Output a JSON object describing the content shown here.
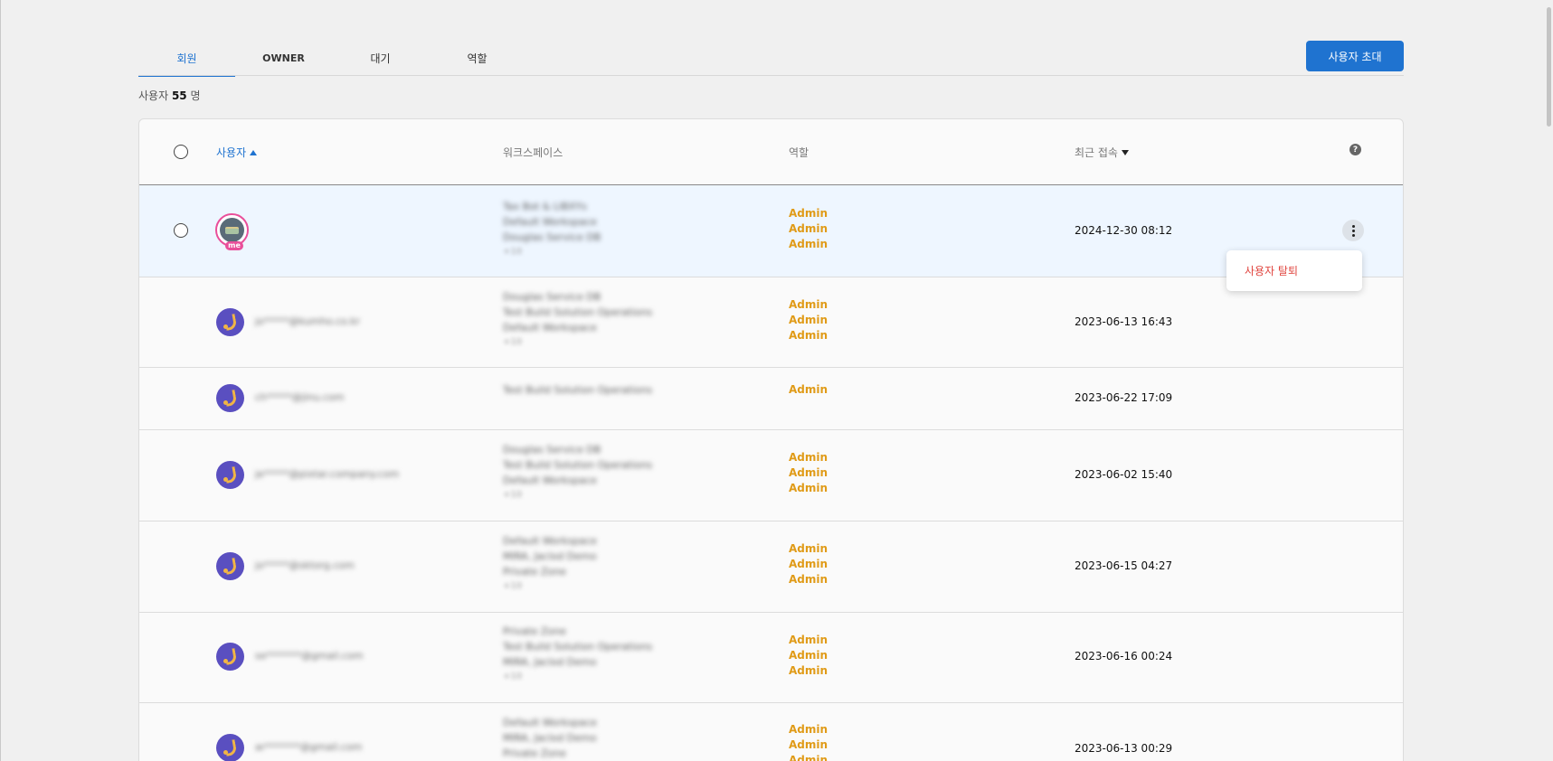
{
  "tabs": [
    {
      "label": "회원",
      "active": true
    },
    {
      "label": "OWNER",
      "active": false
    },
    {
      "label": "대기",
      "active": false
    },
    {
      "label": "역할",
      "active": false
    }
  ],
  "invite_button": "사용자 초대",
  "count": {
    "prefix": "사용자",
    "value": "55",
    "suffix": "명"
  },
  "columns": {
    "user": "사용자",
    "workspace": "워크스페이스",
    "role": "역할",
    "last_access": "최근 접속",
    "help": "?"
  },
  "rows": [
    {
      "me_badge": "me",
      "email": "",
      "workspaces": [
        "Tax Bot & LIBXYs",
        "Default Workspace",
        "Douglas Service DB"
      ],
      "more": "+10",
      "roles": [
        "Admin",
        "Admin",
        "Admin"
      ],
      "last_access": "2024-12-30 08:12"
    },
    {
      "email": "jo*****@kumho.co.kr",
      "workspaces": [
        "Douglas Service DB",
        "Test Build Solution Operations",
        "Default Workspace"
      ],
      "more": "+10",
      "roles": [
        "Admin",
        "Admin",
        "Admin"
      ],
      "last_access": "2023-06-13 16:43"
    },
    {
      "email": "ch*****@jinu.com",
      "workspaces": [
        "Test Build Solution Operations"
      ],
      "more": "",
      "roles": [
        "Admin"
      ],
      "last_access": "2023-06-22 17:09"
    },
    {
      "email": "je*****@pixtar.company.com",
      "workspaces": [
        "Douglas Service DB",
        "Test Build Solution Operations",
        "Default Workspace"
      ],
      "more": "+10",
      "roles": [
        "Admin",
        "Admin",
        "Admin"
      ],
      "last_access": "2023-06-02 15:40"
    },
    {
      "email": "jo*****@sktorg.com",
      "workspaces": [
        "Default Workspace",
        "MIRA, Jaclod Demo",
        "Private Zone"
      ],
      "more": "+10",
      "roles": [
        "Admin",
        "Admin",
        "Admin"
      ],
      "last_access": "2023-06-15 04:27"
    },
    {
      "email": "se*******@gmail.com",
      "workspaces": [
        "Private Zone",
        "Test Build Solution Operations",
        "MIRA, Jaclod Demo"
      ],
      "more": "+10",
      "roles": [
        "Admin",
        "Admin",
        "Admin"
      ],
      "last_access": "2023-06-16 00:24"
    },
    {
      "email": "ar*******@gmail.com",
      "workspaces": [
        "Default Workspace",
        "MIRA, Jaclod Demo",
        "Private Zone"
      ],
      "more": "",
      "roles": [
        "Admin",
        "Admin",
        "Admin"
      ],
      "last_access": "2023-06-13 00:29"
    }
  ],
  "context_menu": {
    "withdraw": "사용자 탈퇴"
  },
  "colors": {
    "accent": "#1f73d0",
    "role": "#e09b18",
    "danger": "#e0443e",
    "me": "#e94f9a"
  }
}
